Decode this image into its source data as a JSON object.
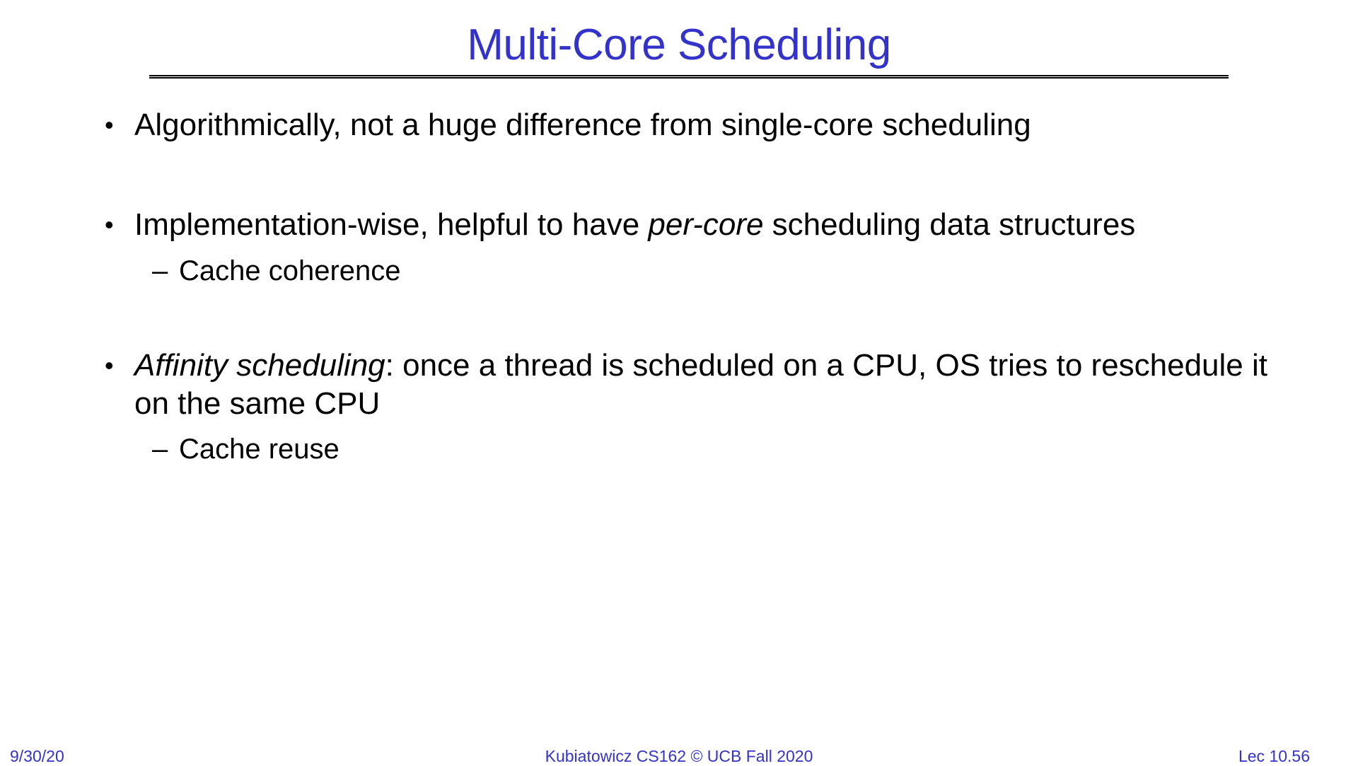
{
  "slide": {
    "title": "Multi-Core Scheduling",
    "bullets": [
      {
        "text": "Algorithmically, not a huge difference from single-core scheduling"
      },
      {
        "text_before": "Implementation-wise, helpful to have ",
        "text_italic": "per-core",
        "text_after": " scheduling data structures",
        "sub": "Cache coherence"
      },
      {
        "text_italic": "Affinity scheduling",
        "text_after": ": once a thread is scheduled on a CPU, OS tries to reschedule it on the same CPU",
        "sub": "Cache reuse"
      }
    ]
  },
  "footer": {
    "date": "9/30/20",
    "course": "Kubiatowicz CS162 © UCB Fall 2020",
    "lecture": "Lec 10.56"
  },
  "colors": {
    "accent": "#3333cc",
    "text": "#000000",
    "background": "#ffffff"
  }
}
